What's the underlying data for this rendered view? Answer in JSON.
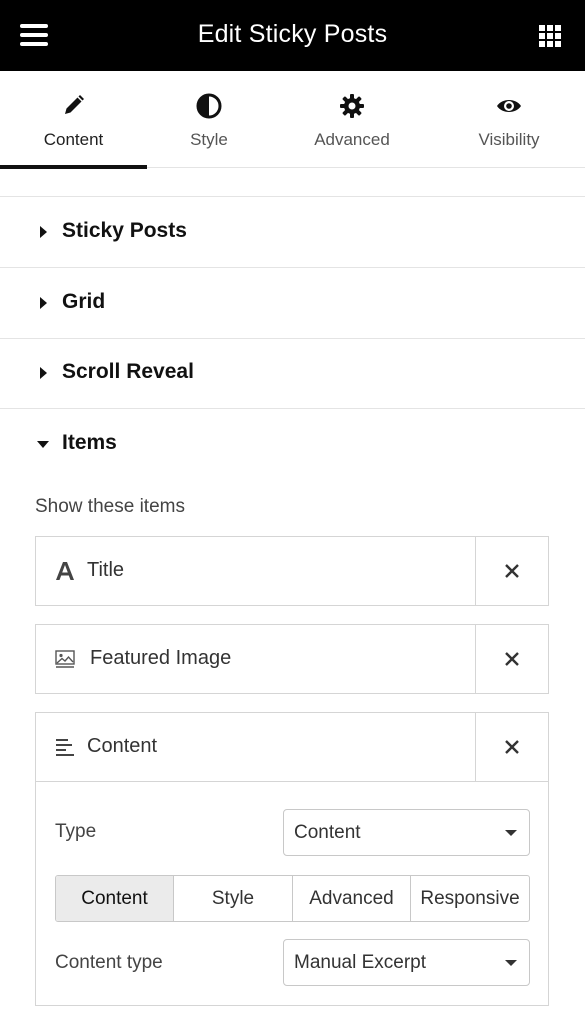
{
  "header": {
    "title": "Edit Sticky Posts",
    "menu_icon": "hamburger-icon",
    "apps_icon": "grid-icon"
  },
  "tabs": [
    {
      "label": "Content",
      "icon": "pencil-icon",
      "active": true
    },
    {
      "label": "Style",
      "icon": "half-circle-icon",
      "active": false
    },
    {
      "label": "Advanced",
      "icon": "gear-icon",
      "active": false
    },
    {
      "label": "Visibility",
      "icon": "eye-icon",
      "active": false
    }
  ],
  "sections": [
    {
      "label": "Sticky Posts",
      "expanded": false
    },
    {
      "label": "Grid",
      "expanded": false
    },
    {
      "label": "Scroll Reveal",
      "expanded": false
    },
    {
      "label": "Items",
      "expanded": true
    }
  ],
  "items_panel": {
    "show_label": "Show these items",
    "items": [
      {
        "label": "Title",
        "icon": "text-a-icon"
      },
      {
        "label": "Featured Image",
        "icon": "image-icon"
      },
      {
        "label": "Content",
        "icon": "align-left-icon"
      }
    ],
    "content_item": {
      "type_label": "Type",
      "type_value": "Content",
      "segments": [
        {
          "label": "Content",
          "active": true
        },
        {
          "label": "Style",
          "active": false
        },
        {
          "label": "Advanced",
          "active": false
        },
        {
          "label": "Responsive",
          "active": false
        }
      ],
      "content_type_label": "Content type",
      "content_type_value": "Manual Excerpt"
    }
  },
  "colors": {
    "header_bg": "#000000",
    "active_tab_bar": "#111111",
    "border": "#d5d5d5"
  }
}
